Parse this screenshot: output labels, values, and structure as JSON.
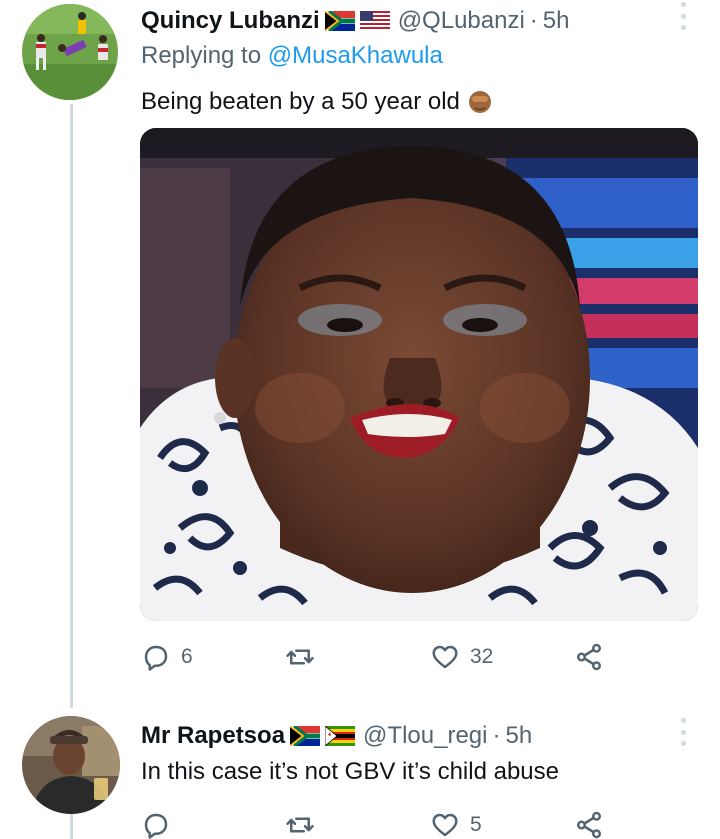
{
  "tweets": [
    {
      "display_name": "Quincy Lubanzi",
      "handle": "@QLubanzi",
      "separator": "·",
      "time": "5h",
      "replying_prefix": "Replying to ",
      "replying_to": "@MusaKhawula",
      "text": "Being beaten by a 50 year old",
      "flags": [
        "south-africa-flag",
        "usa-flag"
      ],
      "emoji": "person-facepalming-emoji",
      "actions": {
        "reply_count": "6",
        "retweet_count": "",
        "like_count": "32"
      }
    },
    {
      "display_name": "Mr Rapetsoa",
      "handle": "@Tlou_regi",
      "separator": "·",
      "time": "5h",
      "text": "In this case it’s not GBV it’s child abuse",
      "flags": [
        "south-africa-flag",
        "zimbabwe-flag"
      ],
      "actions": {
        "reply_count": "",
        "retweet_count": "",
        "like_count": "5"
      }
    }
  ],
  "icons": {
    "reply": "reply-icon",
    "retweet": "retweet-icon",
    "like": "heart-icon",
    "share": "share-icon",
    "more": "more-options-icon"
  },
  "colors": {
    "text": "#0f1419",
    "secondary": "#536471",
    "link": "#1d9bf0",
    "thread_line": "#cfd9de"
  }
}
